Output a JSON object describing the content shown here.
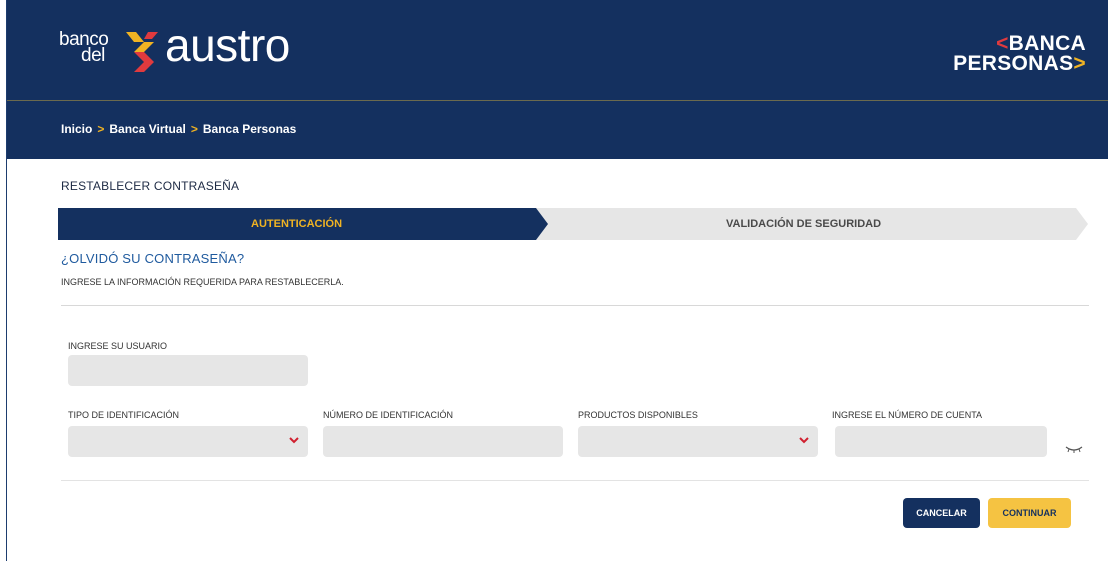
{
  "header": {
    "logo_small_line1": "banco",
    "logo_small_line2": "del",
    "logo_big": "austro",
    "brand_line1": "BANCA",
    "brand_line2": "PERSONAS",
    "brand_chevron_left": "<",
    "brand_chevron_right": ">"
  },
  "breadcrumb": {
    "items": [
      "Inicio",
      "Banca Virtual",
      "Banca Personas"
    ],
    "separator": ">"
  },
  "page": {
    "title": "RESTABLECER CONTRASEÑA",
    "question": "¿OLVIDÓ SU CONTRASEÑA?",
    "instructions": "INGRESE LA INFORMACIÓN REQUERIDA PARA RESTABLECERLA."
  },
  "steps": [
    {
      "label": "AUTENTICACIÓN",
      "active": true
    },
    {
      "label": "VALIDACIÓN DE SEGURIDAD",
      "active": false
    }
  ],
  "form": {
    "usuario_label": "INGRESE SU USUARIO",
    "usuario_value": "",
    "tipo_id_label": "TIPO DE IDENTIFICACIÓN",
    "tipo_id_value": "",
    "numero_id_label": "NÚMERO DE IDENTIFICACIÓN",
    "numero_id_value": "",
    "productos_label": "PRODUCTOS DISPONIBLES",
    "productos_value": "",
    "cuenta_label": "INGRESE EL NÚMERO DE CUENTA",
    "cuenta_value": ""
  },
  "buttons": {
    "cancel": "CANCELAR",
    "continue": "CONTINUAR"
  },
  "colors": {
    "navy": "#14305f",
    "accent_yellow": "#f0b323",
    "accent_red": "#e03a3e",
    "link_blue": "#1f5a9e",
    "field_gray": "#e6e6e6"
  },
  "icons": {
    "select_caret": "chevron-down-icon",
    "password_toggle": "eye-closed-icon"
  }
}
